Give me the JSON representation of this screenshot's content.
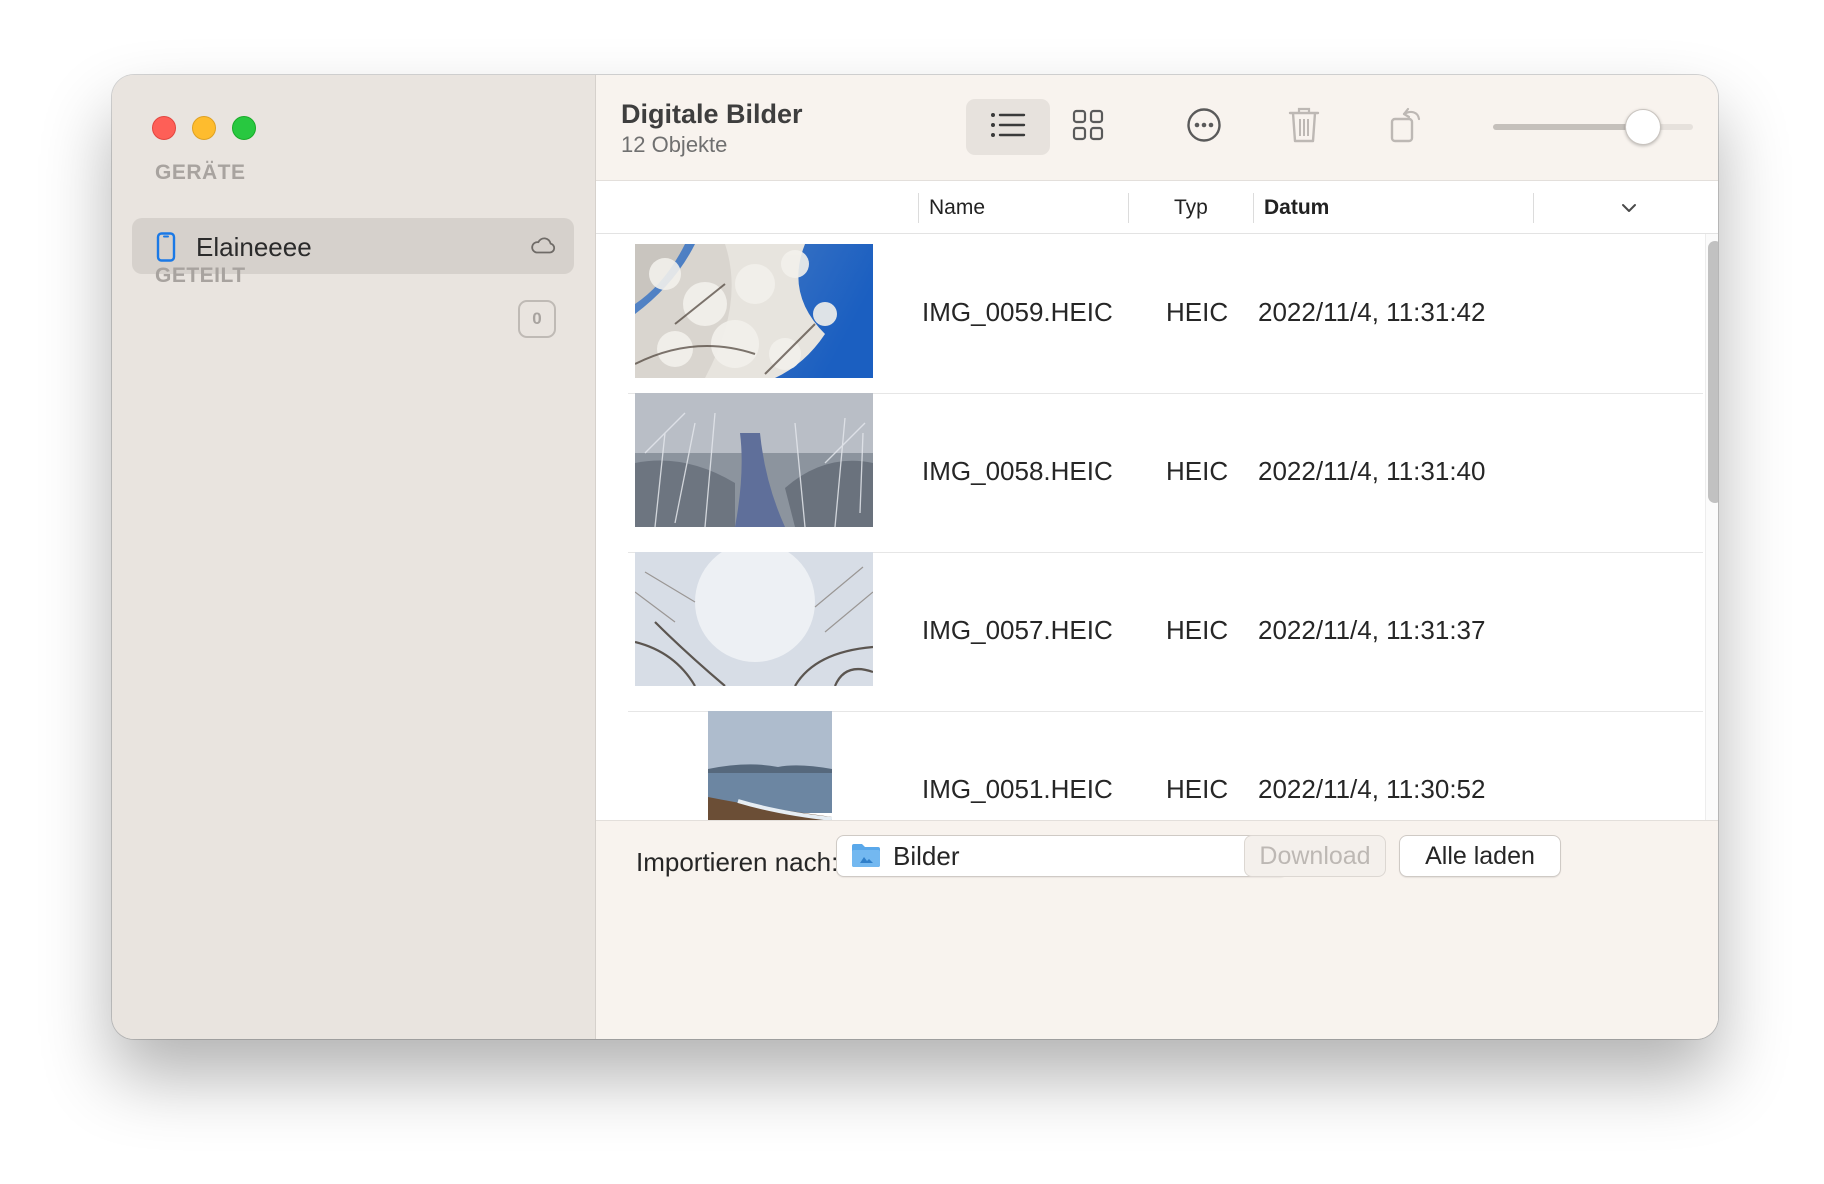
{
  "sidebar": {
    "devices_label": "GERÄTE",
    "device": {
      "name": "Elaineeee"
    },
    "shared_label": "GETEILT",
    "shared_count": "0"
  },
  "header": {
    "title": "Digitale Bilder",
    "subtitle": "12 Objekte",
    "icons": [
      "list-view-icon",
      "grid-view-icon",
      "more-options-icon",
      "trash-icon",
      "rotate-icon"
    ],
    "thumbnail_size_level": 0.75
  },
  "table": {
    "columns": {
      "name": "Name",
      "type": "Typ",
      "date": "Datum"
    },
    "sort_column": "Datum",
    "rows": [
      {
        "name": "IMG_0059.HEIC",
        "type": "HEIC",
        "date": "2022/11/4, 11:31:42"
      },
      {
        "name": "IMG_0058.HEIC",
        "type": "HEIC",
        "date": "2022/11/4, 11:31:40"
      },
      {
        "name": "IMG_0057.HEIC",
        "type": "HEIC",
        "date": "2022/11/4, 11:31:37"
      },
      {
        "name": "IMG_0051.HEIC",
        "type": "HEIC",
        "date": "2022/11/4, 11:30:52"
      }
    ]
  },
  "footer": {
    "import_label": "Importieren nach:",
    "destination": "Bilder",
    "download_label": "Download",
    "load_all_label": "Alle laden"
  },
  "colors": {
    "close": "#fe5f57",
    "minimize": "#febc2e",
    "zoom": "#28c840",
    "accent": "#1a79e6"
  }
}
